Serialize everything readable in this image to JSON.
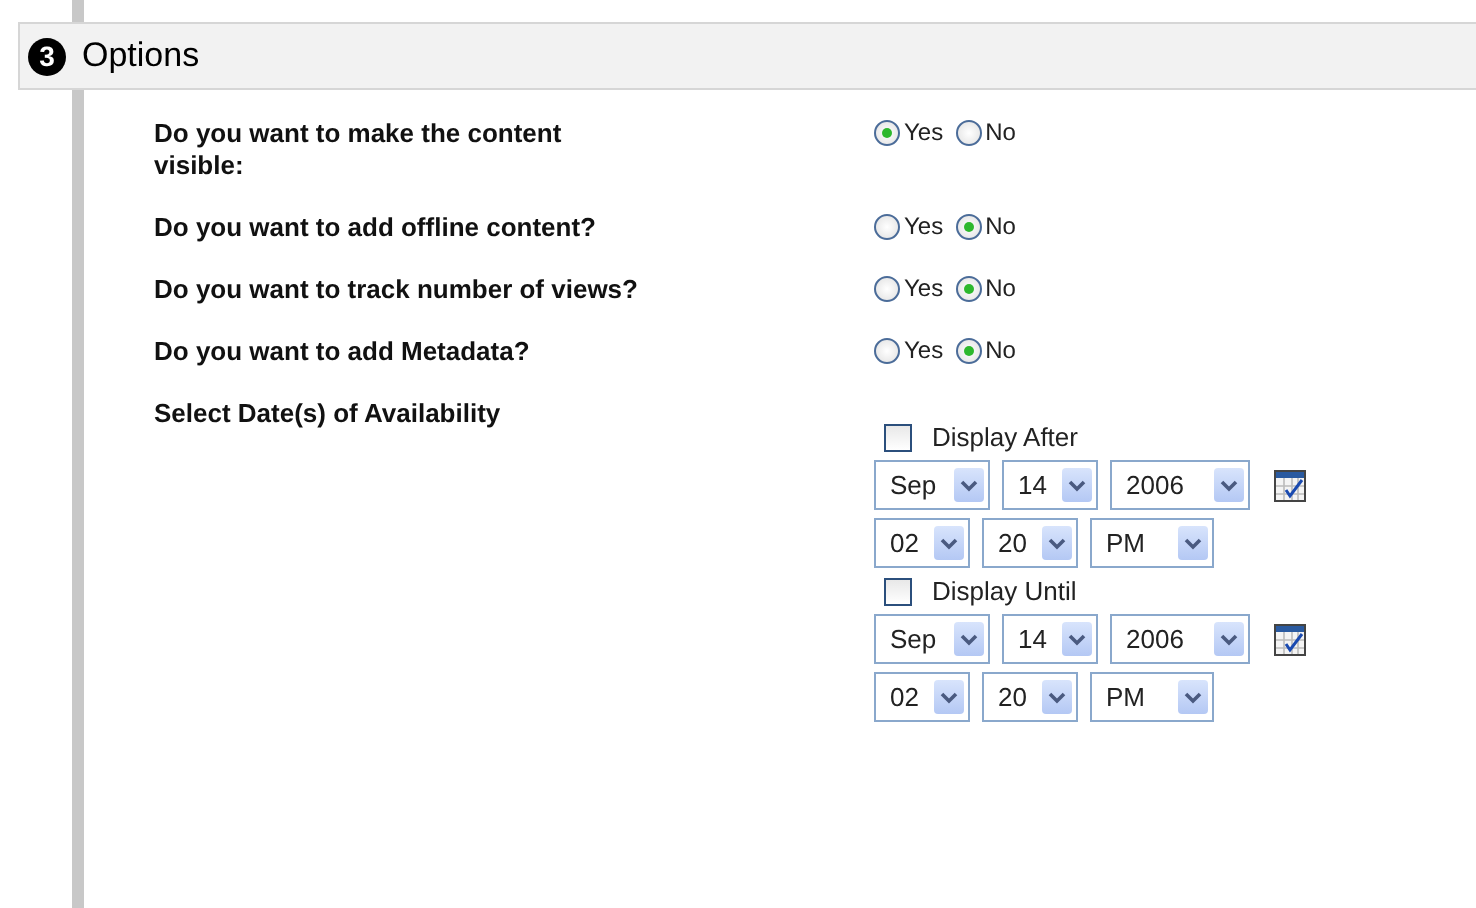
{
  "section": {
    "number": "3",
    "title": "Options"
  },
  "questions": [
    {
      "kind": "radio",
      "label": "Do you want to make the content\nvisible:",
      "options": [
        {
          "label": "Yes",
          "selected": true
        },
        {
          "label": "No",
          "selected": false
        }
      ]
    },
    {
      "kind": "radio",
      "label": "Do you want to add offline content?",
      "options": [
        {
          "label": "Yes",
          "selected": false
        },
        {
          "label": "No",
          "selected": true
        }
      ]
    },
    {
      "kind": "radio",
      "label": "Do you want to track number of views?",
      "options": [
        {
          "label": "Yes",
          "selected": false
        },
        {
          "label": "No",
          "selected": true
        }
      ]
    },
    {
      "kind": "radio",
      "label": "Do you want to add Metadata?",
      "options": [
        {
          "label": "Yes",
          "selected": false
        },
        {
          "label": "No",
          "selected": true
        }
      ]
    },
    {
      "kind": "dates",
      "label": "Select Date(s) of Availability",
      "groups": [
        {
          "label": "Display After",
          "checked": false,
          "date": [
            "Sep",
            "14",
            "2006"
          ],
          "time": [
            "02",
            "20",
            "PM"
          ]
        },
        {
          "label": "Display Until",
          "checked": false,
          "date": [
            "Sep",
            "14",
            "2006"
          ],
          "time": [
            "02",
            "20",
            "PM"
          ]
        }
      ]
    }
  ]
}
